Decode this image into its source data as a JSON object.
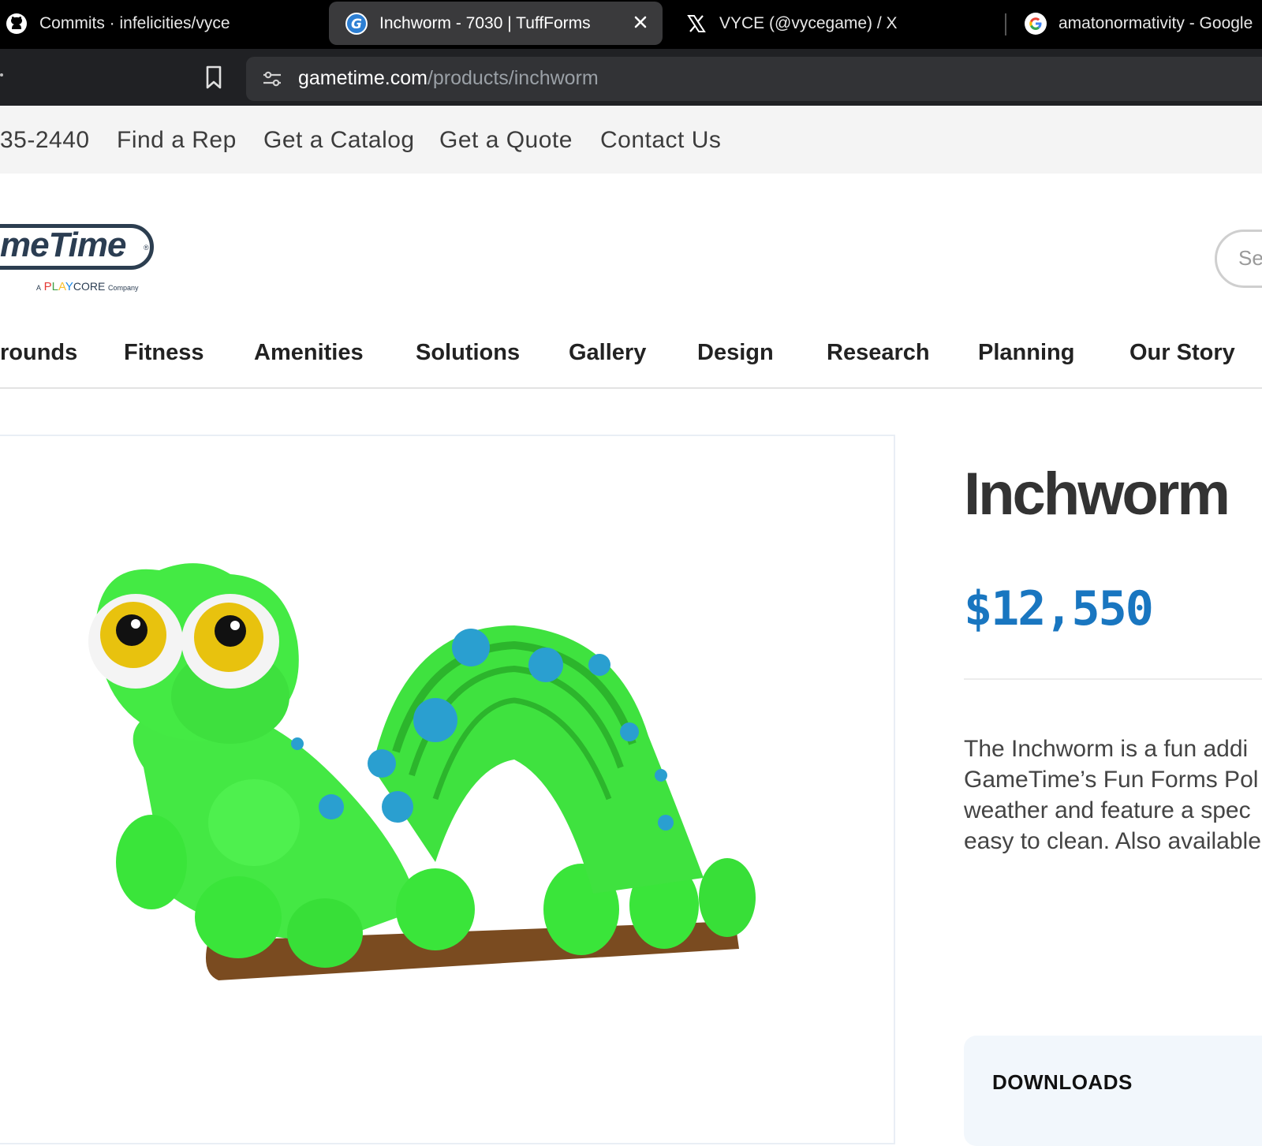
{
  "browser": {
    "tabs": [
      {
        "title": "Commits · infelicities/vyce",
        "icon": "github-icon"
      },
      {
        "title": "Inchworm - 7030 | TuffForms",
        "icon": "gametime-favicon",
        "active": true
      },
      {
        "title": "VYCE (@vycegame) / X",
        "icon": "x-logo-icon"
      },
      {
        "title": "amatonormativity - Google",
        "icon": "google-icon"
      }
    ],
    "url_host": "gametime.com",
    "url_path": "/products/inchworm"
  },
  "utility_nav": [
    "35-2440",
    "Find a Rep",
    "Get a Catalog",
    "Get a Quote",
    "Contact Us"
  ],
  "logo": {
    "text": "meTime",
    "registered": "®",
    "sub_prefix": "A",
    "play_letters": [
      "P",
      "L",
      "A",
      "Y"
    ],
    "core": "CORE",
    "company": "Company"
  },
  "search": {
    "placeholder": "Se"
  },
  "main_nav": [
    "rounds",
    "Fitness",
    "Amenities",
    "Solutions",
    "Gallery",
    "Design",
    "Research",
    "Planning",
    "Our Story"
  ],
  "product": {
    "title": "Inchworm",
    "price": "$12,550",
    "description_lines": [
      "The Inchworm is a fun addi",
      "GameTime’s Fun Forms Pol",
      "weather and feature a spec",
      "easy to clean. Also available"
    ],
    "downloads_label": "DOWNLOADS"
  },
  "colors": {
    "price": "#1976c0",
    "play_p": "#e53935",
    "play_l": "#43a047",
    "play_a": "#fbc02d",
    "play_y": "#1e88e5",
    "worm_body": "#3fe23f",
    "worm_spots": "#2a9fd0"
  }
}
